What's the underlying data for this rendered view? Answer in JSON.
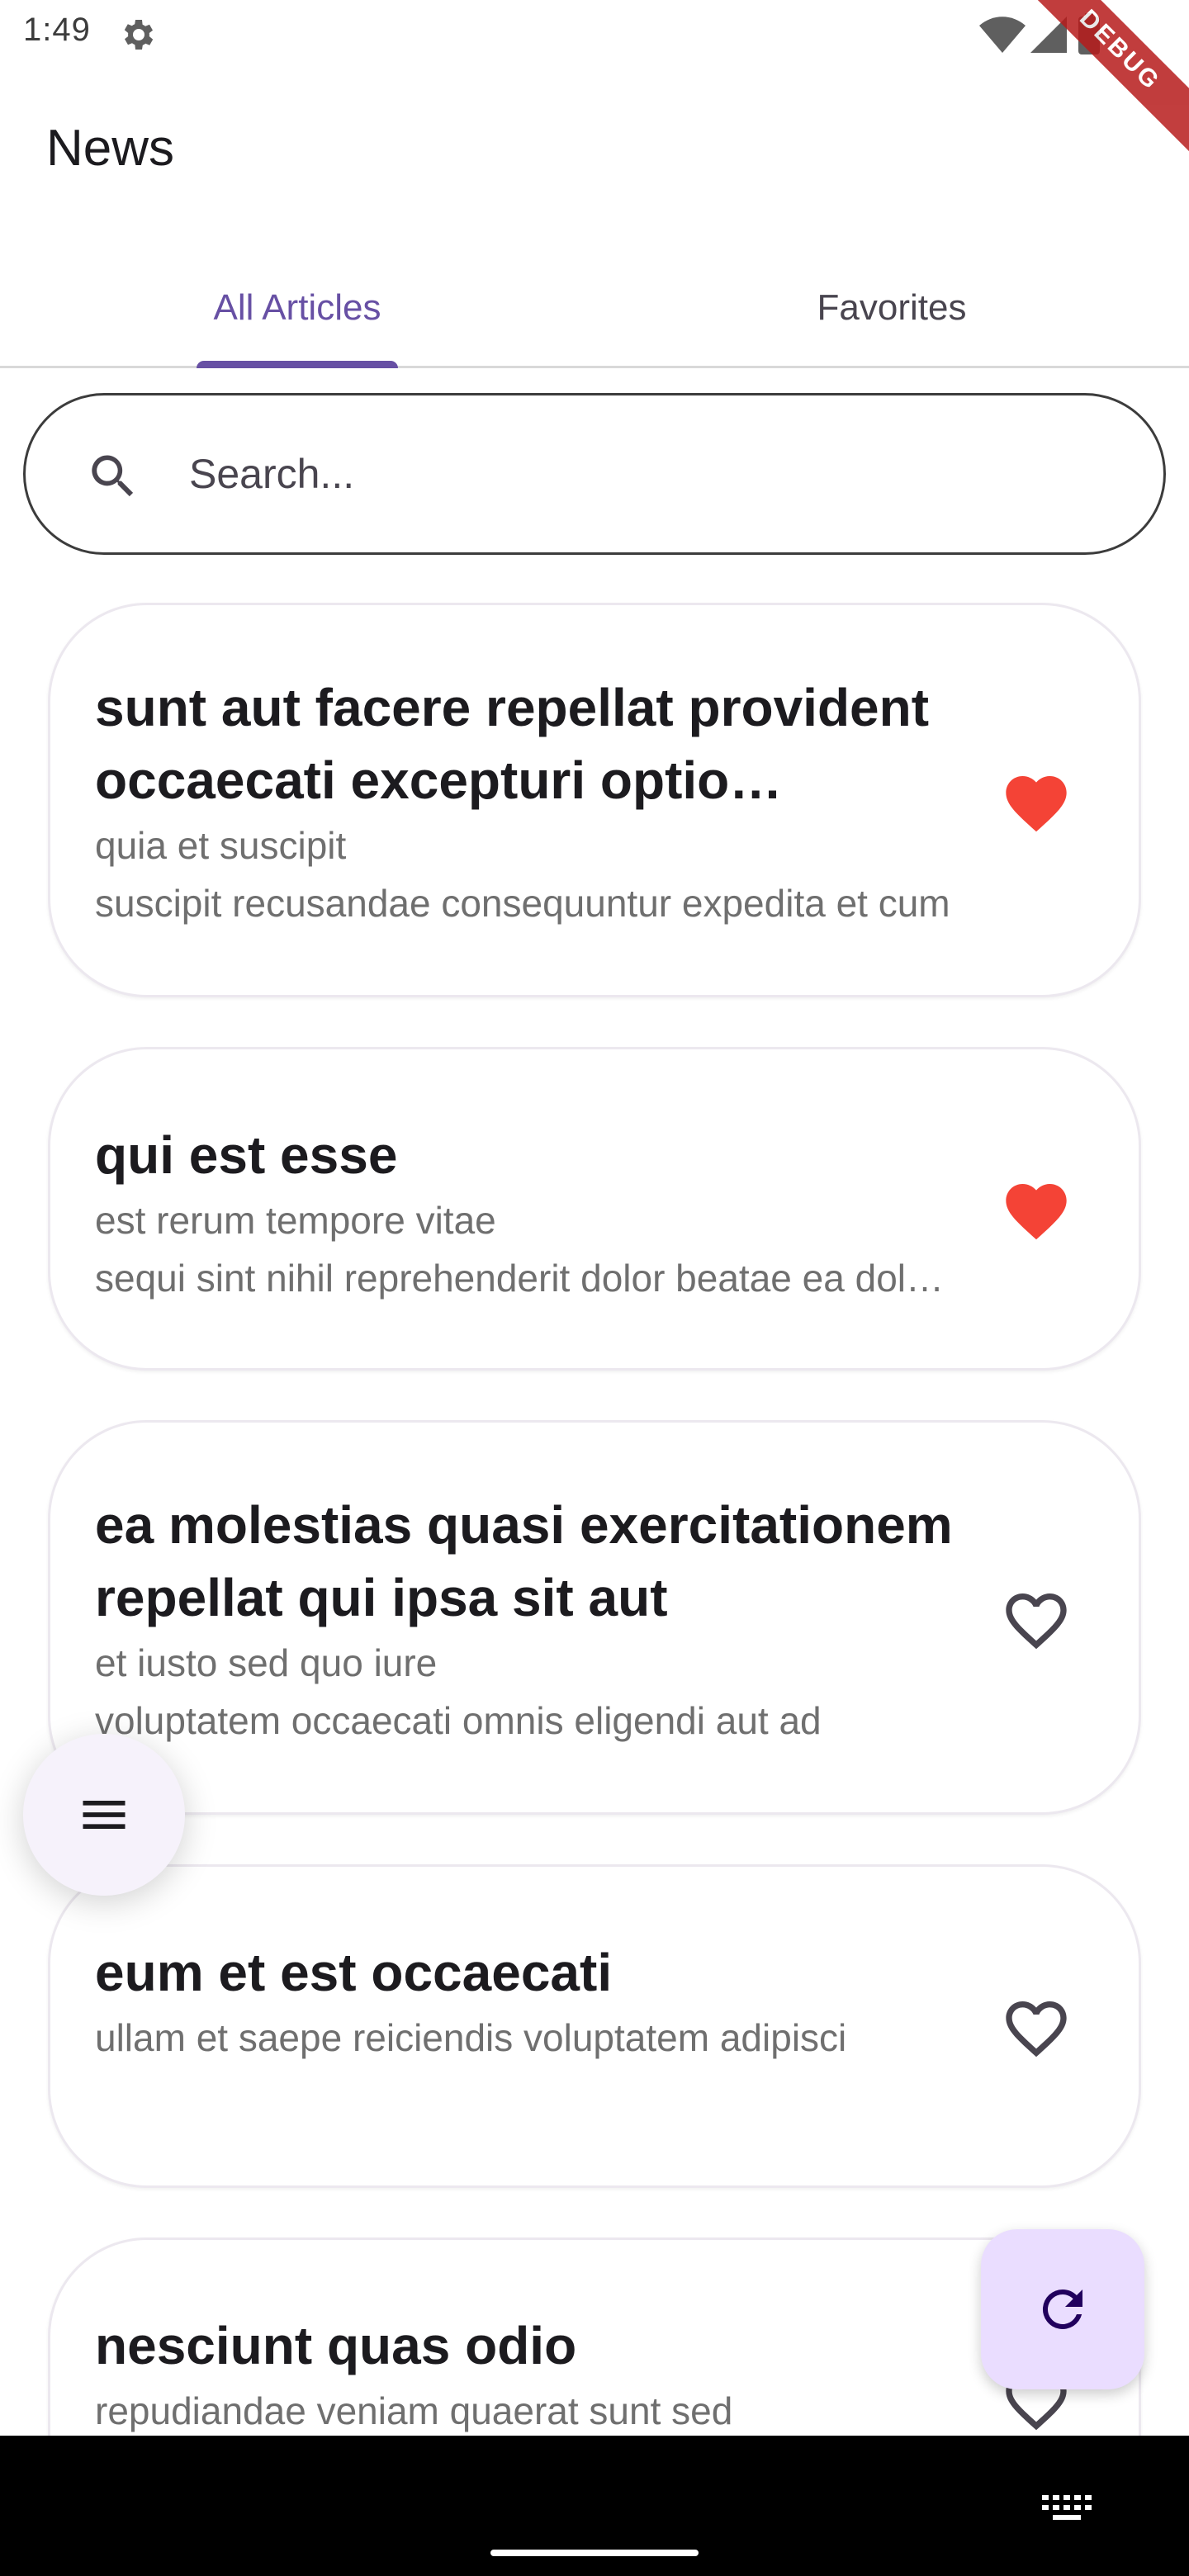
{
  "status_bar": {
    "time": "1:49",
    "icons": [
      "gear-icon",
      "wifi-icon",
      "signal-icon",
      "battery-icon"
    ],
    "debug_banner": "DEBUG"
  },
  "app_bar": {
    "title": "News"
  },
  "tabs": [
    {
      "label": "All Articles",
      "selected": true
    },
    {
      "label": "Favorites",
      "selected": false
    }
  ],
  "search": {
    "placeholder": "Search...",
    "value": ""
  },
  "articles": [
    {
      "title": "sunt aut facere repellat provident occaecati excepturi optio reprehenderit",
      "line1": "quia et suscipit",
      "line2": "suscipit recusandae consequuntur expedita et cum",
      "favorite": true
    },
    {
      "title": "qui est esse",
      "line1": "est rerum tempore vitae",
      "line2": "sequi sint nihil reprehenderit dolor beatae ea dolores neque",
      "favorite": true
    },
    {
      "title": "ea molestias quasi exercitationem repellat qui ipsa sit aut",
      "line1": "et iusto sed quo iure",
      "line2": "voluptatem occaecati omnis eligendi aut ad",
      "favorite": false
    },
    {
      "title": "eum et est occaecati",
      "line1": "ullam et saepe reiciendis voluptatem adipisci",
      "line2": "",
      "favorite": false
    },
    {
      "title": "nesciunt quas odio",
      "line1": "repudiandae veniam quaerat sunt sed",
      "line2": "",
      "favorite": false
    }
  ],
  "colors": {
    "accent": "#6750a4",
    "favorite": "#f44336",
    "fab_refresh_bg": "#eaddff"
  }
}
